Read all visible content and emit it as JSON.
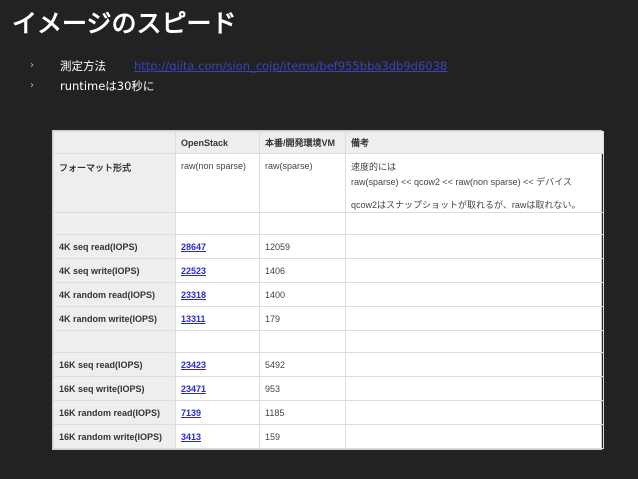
{
  "slide": {
    "title": "イメージのスピード"
  },
  "bullets": [
    {
      "label": "測定方法",
      "link": "http://qiita.com/sion_cojp/items/bef955bba3db9d6038"
    },
    {
      "label": "runtimeは30秒に"
    }
  ],
  "table": {
    "headers": [
      "",
      "OpenStack",
      "本番/開発環境VM",
      "備考"
    ],
    "format_row": {
      "label": "フォーマット形式",
      "openstack": "raw(non sparse)",
      "vm": "raw(sparse)",
      "notes": [
        "速度的には",
        "raw(sparse) << qcow2 << raw(non sparse) << デバイス",
        "qcow2はスナップショットが取れるが、rawは取れない。"
      ]
    },
    "group1": [
      {
        "label": "4K seq read(IOPS)",
        "openstack": "28647",
        "vm": "12059"
      },
      {
        "label": "4K seq write(IOPS)",
        "openstack": "22523",
        "vm": "1406"
      },
      {
        "label": "4K random read(IOPS)",
        "openstack": "23318",
        "vm": "1400"
      },
      {
        "label": "4K random write(IOPS)",
        "openstack": "13311",
        "vm": "179"
      }
    ],
    "group2": [
      {
        "label": "16K seq read(IOPS)",
        "openstack": "23423",
        "vm": "5492"
      },
      {
        "label": "16K seq write(IOPS)",
        "openstack": "23471",
        "vm": "953"
      },
      {
        "label": "16K random read(IOPS)",
        "openstack": "7139",
        "vm": "1185"
      },
      {
        "label": "16K random write(IOPS)",
        "openstack": "3413",
        "vm": "159"
      }
    ]
  }
}
